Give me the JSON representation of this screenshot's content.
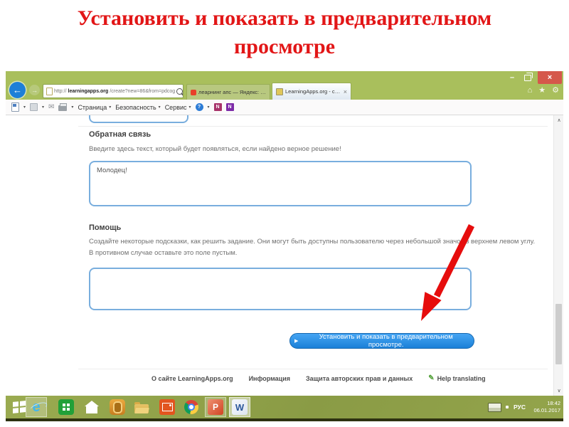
{
  "slide": {
    "title": "Установить и показать в предварительном просмотре",
    "title_color": "#e21617"
  },
  "icons": {
    "caret_down": "▾",
    "back_arrow": "←",
    "forward_arrow": "→",
    "refresh": "↻",
    "play": "▶",
    "home": "⌂",
    "star": "★",
    "gear": "⚙",
    "mail": "✉",
    "help": "?",
    "minimize": "–",
    "close": "×",
    "chevron_up": "∧",
    "chevron_down": "∨",
    "pencil": "✎",
    "letter_n": "N",
    "letter_p": "P",
    "letter_w": "W",
    "letter_e": "e"
  },
  "browser": {
    "url_prefix": "http://",
    "url_domain": "learningapps.org",
    "url_path": "/create?new=86&from=pdcog",
    "tab_yandex": "леарнинг апс — Яндекс: наш...",
    "tab_active": "LearningApps.org - создан...",
    "menu_page": "Страница",
    "menu_security": "Безопасность",
    "menu_tools": "Сервис"
  },
  "page": {
    "feedback_heading": "Обратная связь",
    "feedback_description": "Введите здесь текст, который будет появляться, если найдено верное решение!",
    "feedback_value": "Молодец!",
    "help_heading": "Помощь",
    "help_description_1": "Создайте некоторые подсказки, как решить задание. Они могут быть доступны пользователю через небольшой значок в верхнем левом углу.",
    "help_description_2": "В противном случае оставьте это поле пустым.",
    "help_value": "",
    "submit_label": "Установить и показать в предварительном просмотре.",
    "footer_about": "О сайте LearningApps.org",
    "footer_info": "Информация",
    "footer_copyright": "Защита авторских прав и данных",
    "footer_translate": "Help translating",
    "accent_color": "#1b80d8"
  },
  "taskbar": {
    "lang": "РУС",
    "time": "18:42",
    "date": "06.01.2017"
  }
}
